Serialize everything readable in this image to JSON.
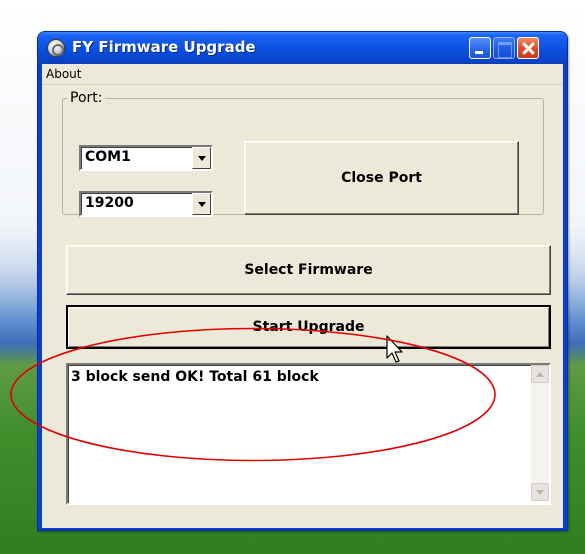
{
  "window": {
    "title": "FY Firmware Upgrade"
  },
  "menu": {
    "items": [
      "About"
    ]
  },
  "port_group": {
    "legend": "Port:",
    "port_combo": {
      "selected": "COM1"
    },
    "baud_combo": {
      "selected": "19200"
    },
    "close_port_label": "Close Port"
  },
  "buttons": {
    "select_firmware_label": "Select Firmware",
    "start_upgrade_label": "Start Upgrade"
  },
  "log": {
    "text": "3 block send OK! Total 61 block"
  },
  "colors": {
    "titlebar": "#0a4fe1",
    "client": "#ece9d8",
    "annotation": "#e10000"
  },
  "icons": {
    "app": "app-disc-icon",
    "minimize": "minimize-icon",
    "maximize": "maximize-icon",
    "close": "close-icon",
    "cursor": "mouse-pointer-icon"
  }
}
